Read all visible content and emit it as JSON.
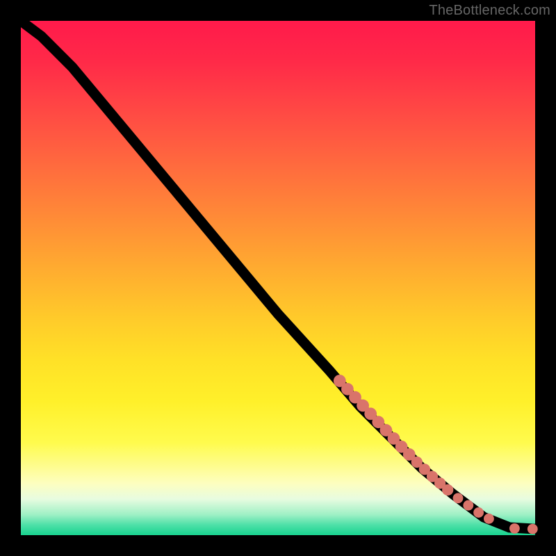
{
  "watermark": "TheBottleneck.com",
  "colors": {
    "marker": "#d9746a",
    "curve": "#000000",
    "background": "#000000"
  },
  "chart_data": {
    "type": "line",
    "title": "",
    "xlabel": "",
    "ylabel": "",
    "xlim": [
      0,
      100
    ],
    "ylim": [
      0,
      100
    ],
    "curve": [
      {
        "x": 0,
        "y": 100
      },
      {
        "x": 4,
        "y": 97
      },
      {
        "x": 10,
        "y": 91
      },
      {
        "x": 20,
        "y": 79
      },
      {
        "x": 30,
        "y": 67
      },
      {
        "x": 40,
        "y": 55
      },
      {
        "x": 50,
        "y": 43
      },
      {
        "x": 60,
        "y": 32
      },
      {
        "x": 66,
        "y": 25
      },
      {
        "x": 72,
        "y": 19
      },
      {
        "x": 78,
        "y": 13
      },
      {
        "x": 84,
        "y": 8
      },
      {
        "x": 90,
        "y": 3.5
      },
      {
        "x": 95,
        "y": 1.5
      },
      {
        "x": 100,
        "y": 1.2
      }
    ],
    "markers": [
      {
        "x": 62,
        "y": 30,
        "r": 1.2
      },
      {
        "x": 63.5,
        "y": 28.4,
        "r": 1.2
      },
      {
        "x": 65,
        "y": 26.8,
        "r": 1.2
      },
      {
        "x": 66.5,
        "y": 25.2,
        "r": 1.2
      },
      {
        "x": 68,
        "y": 23.6,
        "r": 1.2
      },
      {
        "x": 69.5,
        "y": 22,
        "r": 1.2
      },
      {
        "x": 71,
        "y": 20.4,
        "r": 1.2
      },
      {
        "x": 72.5,
        "y": 18.8,
        "r": 1.2
      },
      {
        "x": 74,
        "y": 17.2,
        "r": 1.2
      },
      {
        "x": 75.5,
        "y": 15.7,
        "r": 1.2
      },
      {
        "x": 77,
        "y": 14.2,
        "r": 1.1
      },
      {
        "x": 78.5,
        "y": 12.8,
        "r": 1.1
      },
      {
        "x": 80,
        "y": 11.4,
        "r": 1.1
      },
      {
        "x": 81.5,
        "y": 10.1,
        "r": 1.1
      },
      {
        "x": 83,
        "y": 8.8,
        "r": 1.1
      },
      {
        "x": 85,
        "y": 7.2,
        "r": 1.0
      },
      {
        "x": 87,
        "y": 5.8,
        "r": 1.0
      },
      {
        "x": 89,
        "y": 4.4,
        "r": 1.0
      },
      {
        "x": 91,
        "y": 3.2,
        "r": 1.0
      },
      {
        "x": 96,
        "y": 1.3,
        "r": 1.0
      },
      {
        "x": 99.5,
        "y": 1.2,
        "r": 1.0
      }
    ]
  }
}
